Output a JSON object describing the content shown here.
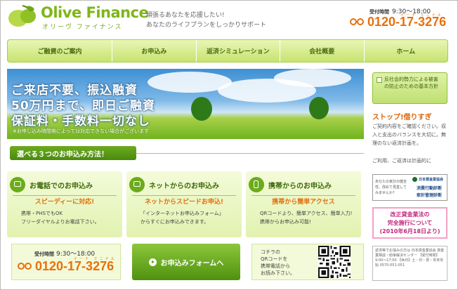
{
  "header": {
    "logo_title": "Olive Finance",
    "logo_sub": "オリーヴ ファイナンス",
    "tagline1": "頑張るあなたを応援したい!",
    "tagline2": "あなたのライフプランをしっかりサポート",
    "hours_label": "受付時間",
    "hours": "9:30～18:00",
    "phone_kana": "イーナ ミニナル",
    "phone": "0120-17-3276"
  },
  "nav": {
    "items": [
      "ご融資のご案内",
      "お申込み",
      "返済シミュレーション",
      "会社概要",
      "ホーム"
    ]
  },
  "hero": {
    "line1": "ご来店不要、振込融資",
    "line2": "50万円まで、即日ご融資",
    "line3": "保証料・手数料一切なし",
    "note": "※お申し込み時間帯によっては対応できない場合がございます"
  },
  "sidebar": {
    "antisocial": "反社会的勢力による被害の防止のための基本方針",
    "stop_title": "ストップ!借りすぎ",
    "stop_text": "ご契約内容をご確認ください。収入と支出のバランスを大切に。無理のない返済計画を。",
    "note": "ご利用、ご返済は計画的に",
    "jfsa_left": "あなたの家計の健全性、改めて見直してみませんか?",
    "jfsa_logo": "日本貸金業協会",
    "jfsa_r1": "消費行動診断",
    "jfsa_r2": "家計管理診断",
    "law_line1": "改正貸金業法の",
    "law_line2": "完全施行について",
    "law_line3": "(2010年6月18日より)",
    "info": "返済等でお悩みの方は 日本貸金業協会 貸金業相談・紛争解決センター 【受付時間】9:00～17:00 【休日】土・日・祝・年末年始 0570-051-051"
  },
  "section": {
    "title": "選べる３つのお申込み方法！"
  },
  "methods": [
    {
      "title": "お電話でのお申込み",
      "head": "スピーディーに対応!",
      "body1": "携帯・PHSでもOK",
      "body2": "フリーダイヤルよりお電話下さい。"
    },
    {
      "title": "ネットからのお申込み",
      "head": "ネットからスピードお申込!",
      "body1": "「インターネットお申込みフォーム」",
      "body2": "からすぐにお申込みできます。"
    },
    {
      "title": "携帯からのお申込み",
      "head": "携帯から簡単アクセス",
      "body1": "QRコードより、簡単アクセス、簡単入力!",
      "body2": "携帯からお申込み可能!"
    }
  ],
  "bottom": {
    "hours_label": "受付時間",
    "hours": "9:30～18:00",
    "phone_kana": "イーナ ミニナル",
    "phone": "0120-17-3276",
    "form_button": "お申込みフォームへ",
    "qr_line1": "コチラの",
    "qr_line2": "QRコードを",
    "qr_line3": "携帯電話から",
    "qr_line4": "お読み下さい。"
  }
}
